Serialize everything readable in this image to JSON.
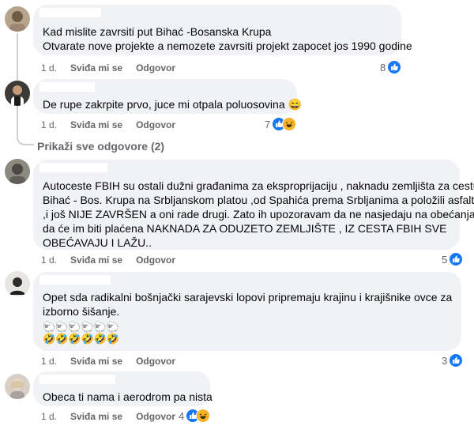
{
  "comments": [
    {
      "lines": [
        "Kad mislite zavrsiti put Bihać -Bosanska Krupa",
        "Otvarate nove projekte a nemozete zavrsiti projekt zapocet jos 1990 godine"
      ],
      "time": "1 d.",
      "like_label": "Sviđa mi se",
      "reply_label": "Odgovor",
      "reaction_count": "8"
    },
    {
      "lines": [
        "De rupe zakrpite prvo, juce mi otpala poluosovina 😄"
      ],
      "time": "1 d.",
      "like_label": "Sviđa mi se",
      "reply_label": "Odgovor",
      "reaction_count": "7"
    },
    {
      "lines": [
        "Autoceste FBIH su ostali dužni građanima za eksproprijaciju , naknadu zemljišta za cestu",
        "Bihać - Bos. Krupa na Srbljanskom platou ,od Spahića prema Srbljanima a položili asfalt",
        ",i još NIJE ZAVRŠEN a oni rade drugi. Zato ih upozoravam da ne nasjedaju na obećanja",
        "da će im biti plaćena NAKNADA ZA ODUZETO ZEMLJIŠTE , IZ CESTA FBIH SVE",
        "OBEĆAVAJU I LAŽU.."
      ],
      "time": "1 d.",
      "like_label": "Sviđa mi se",
      "reply_label": "Odgovor",
      "reaction_count": "5"
    },
    {
      "lines": [
        "Opet sda radikalni bošnjački sarajevski lopovi pripremaju krajinu i krajišnike ovce za",
        "izborno šišanje."
      ],
      "emoji_line_1": "🐑🐑🐑🐑🐑🐑",
      "emoji_line_2": "🤣🤣🤣🤣🤣🤣",
      "time": "1 d.",
      "like_label": "Sviđa mi se",
      "reply_label": "Odgovor",
      "reaction_count": "3"
    },
    {
      "lines": [
        "Obeca ti nama i aerodrom pa nista"
      ],
      "time": "1 d.",
      "like_label": "Sviđa mi se",
      "reply_label": "Odgovor",
      "reaction_count": "4"
    }
  ],
  "view_more_replies": "Prikaži sve odgovore (2)",
  "reaction_icons": {
    "like": "like-icon",
    "haha": "haha-icon"
  },
  "colors": {
    "bubble": "#f0f2f5",
    "like": "#1877f2",
    "haha": "#f7b125",
    "meta": "#65676b"
  }
}
